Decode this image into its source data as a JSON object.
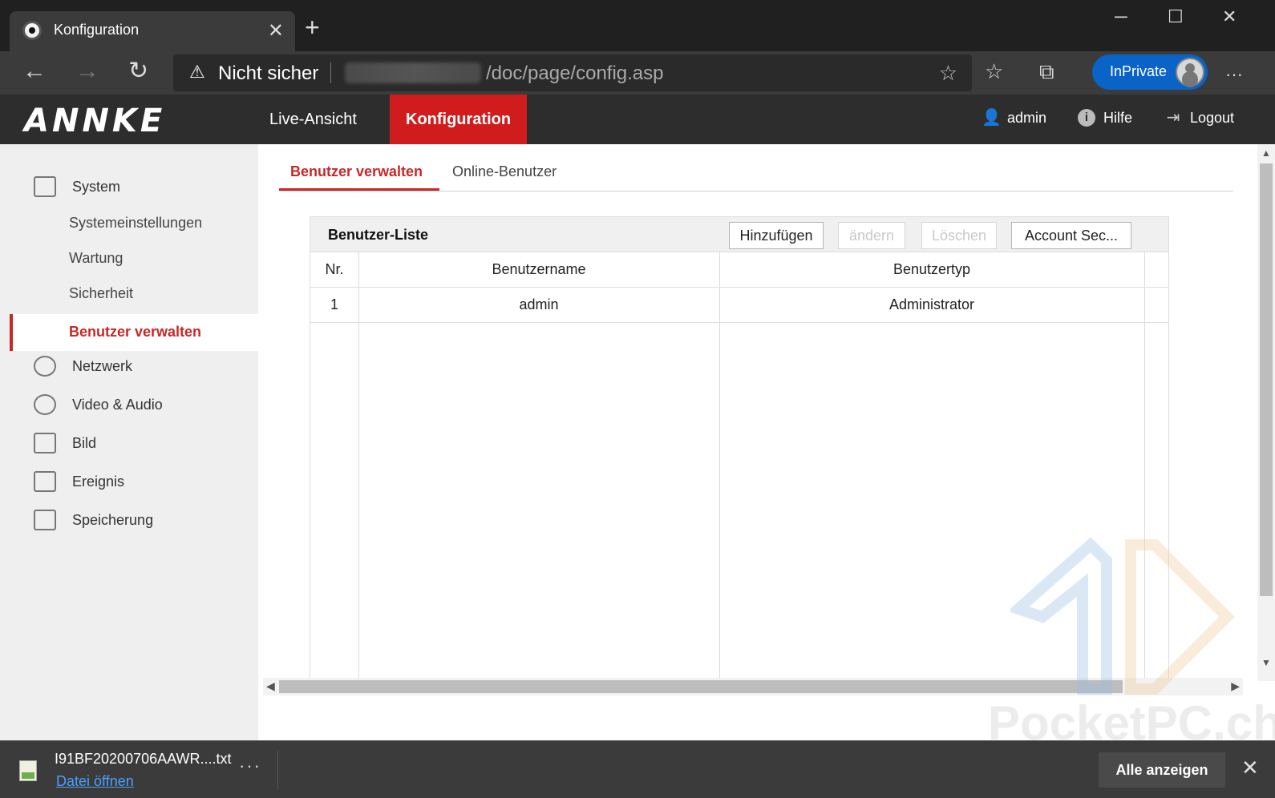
{
  "browser": {
    "tab_title": "Konfiguration",
    "tab_close": "✕",
    "new_tab": "+",
    "security_label": "Nicht sicher",
    "url_path": "/doc/page/config.asp",
    "inprivate_label": "InPrivate",
    "more_menu": "···"
  },
  "app": {
    "logo": "ANNKE",
    "nav": [
      "Live-Ansicht",
      "Konfiguration"
    ],
    "user": "admin",
    "help": "Hilfe",
    "logout": "Logout"
  },
  "sidebar": {
    "system": "System",
    "sub_items": [
      "Systemeinstellungen",
      "Wartung",
      "Sicherheit",
      "Benutzer verwalten"
    ],
    "sections": [
      "Netzwerk",
      "Video & Audio",
      "Bild",
      "Ereignis",
      "Speicherung"
    ]
  },
  "content": {
    "tabs": [
      "Benutzer verwalten",
      "Online-Benutzer"
    ],
    "list_title": "Benutzer-Liste",
    "buttons": {
      "add": "Hinzufügen",
      "edit": "ändern",
      "delete": "Löschen",
      "account": "Account Sec..."
    },
    "table": {
      "headers": [
        "Nr.",
        "Benutzername",
        "Benutzertyp"
      ],
      "rows": [
        {
          "nr": "1",
          "name": "admin",
          "type": "Administrator"
        }
      ]
    }
  },
  "watermark": "PocketPC.ch",
  "download": {
    "file_name": "I91BF20200706AAWR....txt",
    "open_link": "Datei öffnen",
    "more": "···",
    "show_all": "Alle anzeigen"
  }
}
